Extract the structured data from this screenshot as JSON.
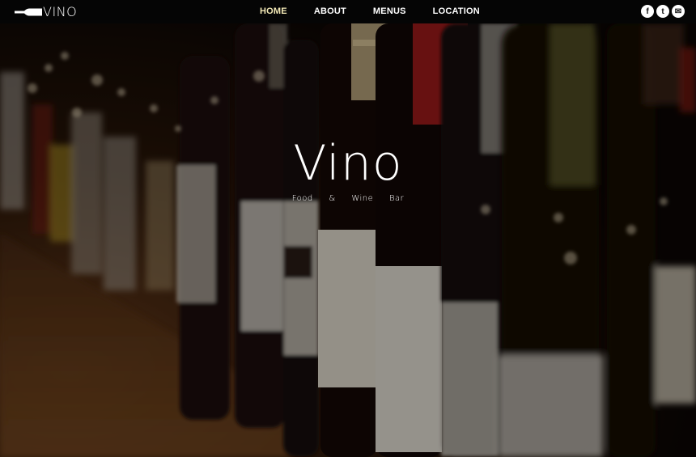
{
  "brand": {
    "name": "VINO",
    "logo_icon": "wine-bottle-icon"
  },
  "nav": {
    "items": [
      {
        "label": "HOME",
        "active": true
      },
      {
        "label": "ABOUT",
        "active": false
      },
      {
        "label": "MENUS",
        "active": false
      },
      {
        "label": "LOCATION",
        "active": false
      }
    ],
    "active_color": "#f3e9b6"
  },
  "social": [
    {
      "icon": "facebook-icon",
      "glyph": "f"
    },
    {
      "icon": "twitter-icon",
      "glyph": "t"
    },
    {
      "icon": "email-icon",
      "glyph": "✉"
    }
  ],
  "hero": {
    "title": "Vino",
    "subtitle": "Food & Wine Bar"
  }
}
